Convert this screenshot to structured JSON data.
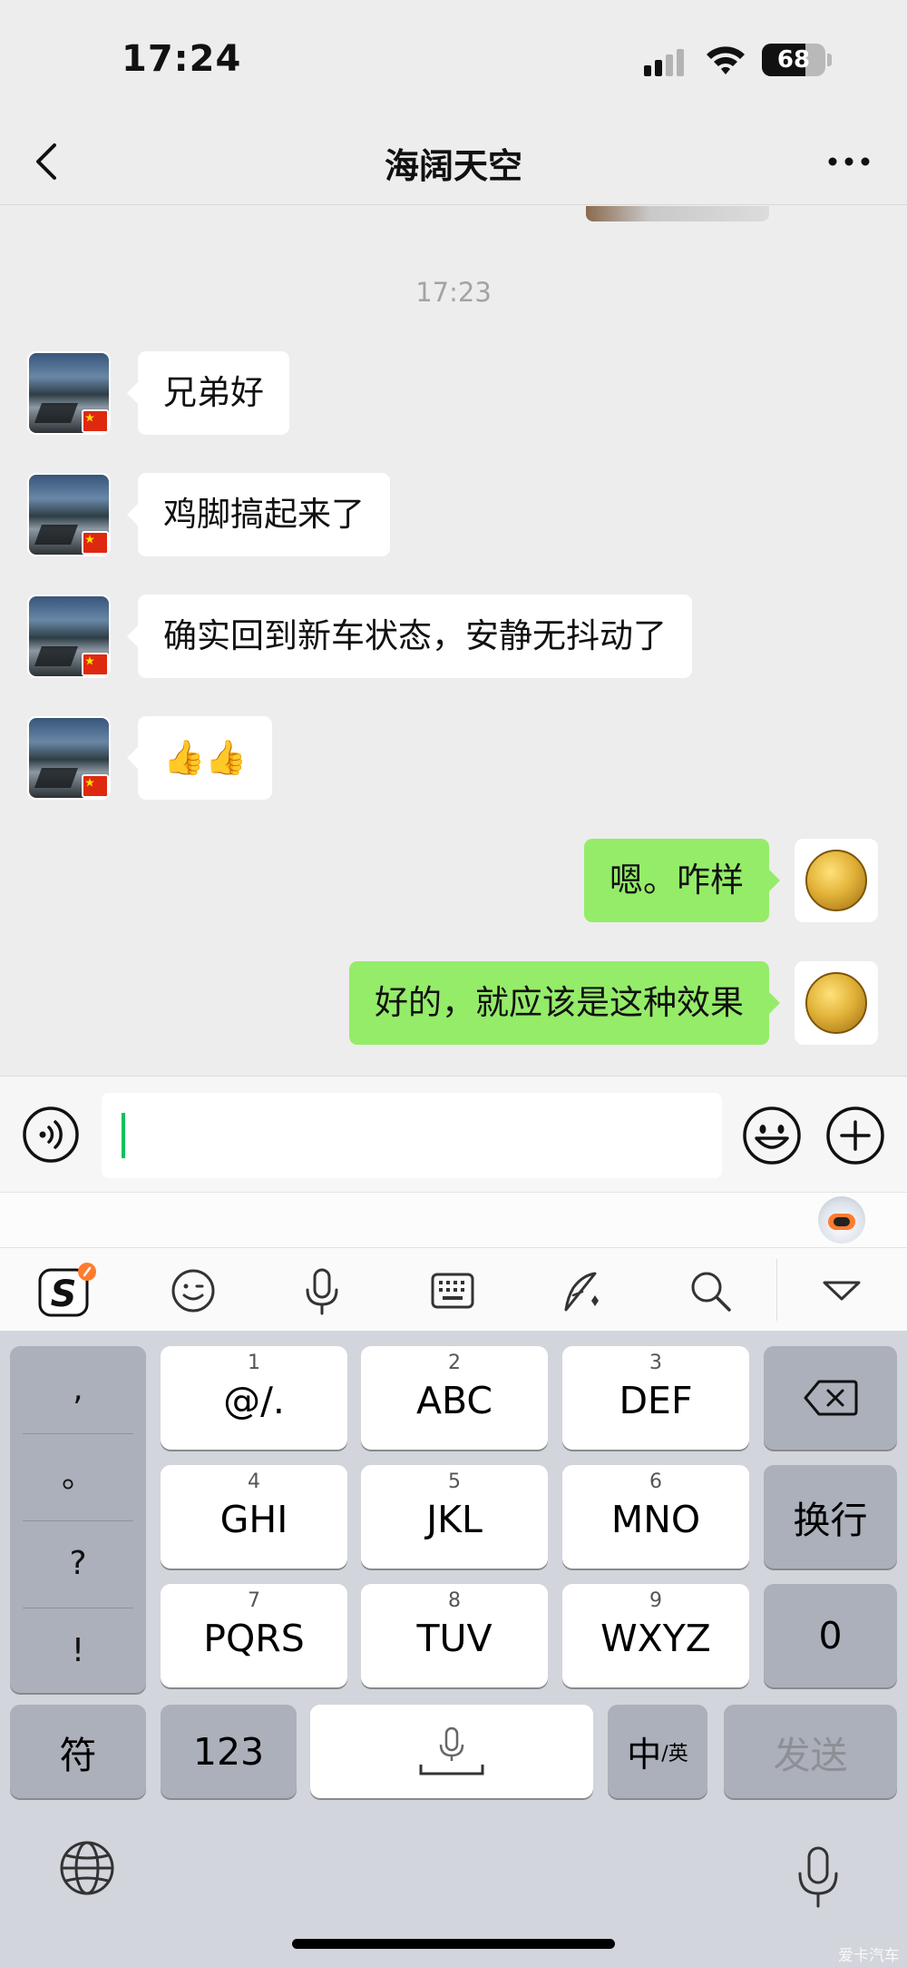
{
  "status_bar": {
    "time": "17:24",
    "battery": "68"
  },
  "nav": {
    "title": "海阔天空"
  },
  "chat": {
    "timestamp": "17:23",
    "messages": [
      {
        "side": "left",
        "text": "兄弟好"
      },
      {
        "side": "left",
        "text": "鸡脚搞起来了"
      },
      {
        "side": "left",
        "text": "确实回到新车状态，安静无抖动了"
      },
      {
        "side": "left",
        "text": "👍👍"
      },
      {
        "side": "right",
        "text": "嗯。咋样"
      },
      {
        "side": "right",
        "text": "好的，就应该是这种效果"
      }
    ]
  },
  "keyboard": {
    "punctuation": [
      ",",
      "。",
      "?",
      "!"
    ],
    "keys": [
      {
        "num": "1",
        "label": "@/."
      },
      {
        "num": "2",
        "label": "ABC"
      },
      {
        "num": "3",
        "label": "DEF"
      },
      {
        "num": "4",
        "label": "GHI"
      },
      {
        "num": "5",
        "label": "JKL"
      },
      {
        "num": "6",
        "label": "MNO"
      },
      {
        "num": "7",
        "label": "PQRS"
      },
      {
        "num": "8",
        "label": "TUV"
      },
      {
        "num": "9",
        "label": "WXYZ"
      }
    ],
    "newline": "换行",
    "zero": "0",
    "symbols": "符",
    "numbers": "123",
    "lang_main": "中",
    "lang_sub": "/英",
    "send": "发送"
  },
  "watermark": "爱卡汽车",
  "colors": {
    "chat_background": "#ededed",
    "sent_bubble": "#95ec69",
    "received_bubble": "#ffffff",
    "cursor": "#07c160",
    "keyboard_background": "#d2d5db"
  }
}
